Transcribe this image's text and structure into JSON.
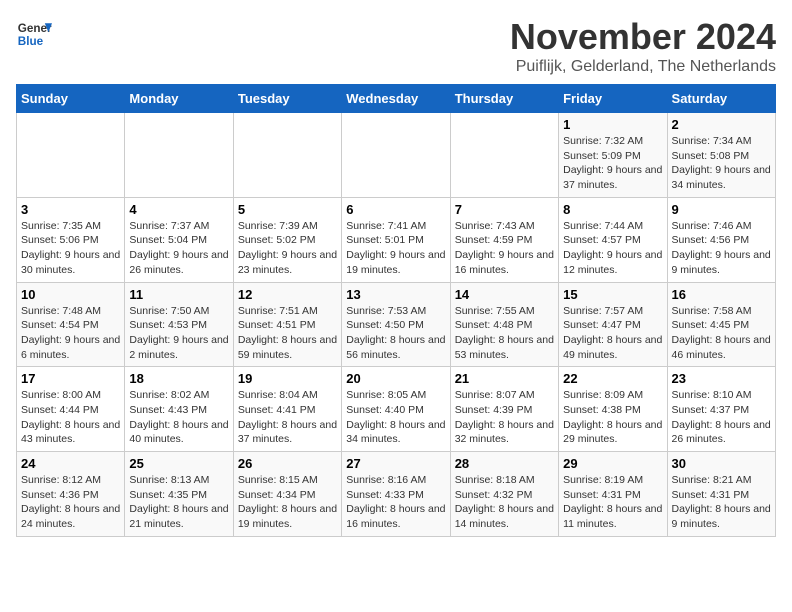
{
  "logo": {
    "line1": "General",
    "line2": "Blue"
  },
  "title": "November 2024",
  "location": "Puiflijk, Gelderland, The Netherlands",
  "headers": [
    "Sunday",
    "Monday",
    "Tuesday",
    "Wednesday",
    "Thursday",
    "Friday",
    "Saturday"
  ],
  "weeks": [
    [
      {
        "day": "",
        "info": ""
      },
      {
        "day": "",
        "info": ""
      },
      {
        "day": "",
        "info": ""
      },
      {
        "day": "",
        "info": ""
      },
      {
        "day": "",
        "info": ""
      },
      {
        "day": "1",
        "info": "Sunrise: 7:32 AM\nSunset: 5:09 PM\nDaylight: 9 hours and 37 minutes."
      },
      {
        "day": "2",
        "info": "Sunrise: 7:34 AM\nSunset: 5:08 PM\nDaylight: 9 hours and 34 minutes."
      }
    ],
    [
      {
        "day": "3",
        "info": "Sunrise: 7:35 AM\nSunset: 5:06 PM\nDaylight: 9 hours and 30 minutes."
      },
      {
        "day": "4",
        "info": "Sunrise: 7:37 AM\nSunset: 5:04 PM\nDaylight: 9 hours and 26 minutes."
      },
      {
        "day": "5",
        "info": "Sunrise: 7:39 AM\nSunset: 5:02 PM\nDaylight: 9 hours and 23 minutes."
      },
      {
        "day": "6",
        "info": "Sunrise: 7:41 AM\nSunset: 5:01 PM\nDaylight: 9 hours and 19 minutes."
      },
      {
        "day": "7",
        "info": "Sunrise: 7:43 AM\nSunset: 4:59 PM\nDaylight: 9 hours and 16 minutes."
      },
      {
        "day": "8",
        "info": "Sunrise: 7:44 AM\nSunset: 4:57 PM\nDaylight: 9 hours and 12 minutes."
      },
      {
        "day": "9",
        "info": "Sunrise: 7:46 AM\nSunset: 4:56 PM\nDaylight: 9 hours and 9 minutes."
      }
    ],
    [
      {
        "day": "10",
        "info": "Sunrise: 7:48 AM\nSunset: 4:54 PM\nDaylight: 9 hours and 6 minutes."
      },
      {
        "day": "11",
        "info": "Sunrise: 7:50 AM\nSunset: 4:53 PM\nDaylight: 9 hours and 2 minutes."
      },
      {
        "day": "12",
        "info": "Sunrise: 7:51 AM\nSunset: 4:51 PM\nDaylight: 8 hours and 59 minutes."
      },
      {
        "day": "13",
        "info": "Sunrise: 7:53 AM\nSunset: 4:50 PM\nDaylight: 8 hours and 56 minutes."
      },
      {
        "day": "14",
        "info": "Sunrise: 7:55 AM\nSunset: 4:48 PM\nDaylight: 8 hours and 53 minutes."
      },
      {
        "day": "15",
        "info": "Sunrise: 7:57 AM\nSunset: 4:47 PM\nDaylight: 8 hours and 49 minutes."
      },
      {
        "day": "16",
        "info": "Sunrise: 7:58 AM\nSunset: 4:45 PM\nDaylight: 8 hours and 46 minutes."
      }
    ],
    [
      {
        "day": "17",
        "info": "Sunrise: 8:00 AM\nSunset: 4:44 PM\nDaylight: 8 hours and 43 minutes."
      },
      {
        "day": "18",
        "info": "Sunrise: 8:02 AM\nSunset: 4:43 PM\nDaylight: 8 hours and 40 minutes."
      },
      {
        "day": "19",
        "info": "Sunrise: 8:04 AM\nSunset: 4:41 PM\nDaylight: 8 hours and 37 minutes."
      },
      {
        "day": "20",
        "info": "Sunrise: 8:05 AM\nSunset: 4:40 PM\nDaylight: 8 hours and 34 minutes."
      },
      {
        "day": "21",
        "info": "Sunrise: 8:07 AM\nSunset: 4:39 PM\nDaylight: 8 hours and 32 minutes."
      },
      {
        "day": "22",
        "info": "Sunrise: 8:09 AM\nSunset: 4:38 PM\nDaylight: 8 hours and 29 minutes."
      },
      {
        "day": "23",
        "info": "Sunrise: 8:10 AM\nSunset: 4:37 PM\nDaylight: 8 hours and 26 minutes."
      }
    ],
    [
      {
        "day": "24",
        "info": "Sunrise: 8:12 AM\nSunset: 4:36 PM\nDaylight: 8 hours and 24 minutes."
      },
      {
        "day": "25",
        "info": "Sunrise: 8:13 AM\nSunset: 4:35 PM\nDaylight: 8 hours and 21 minutes."
      },
      {
        "day": "26",
        "info": "Sunrise: 8:15 AM\nSunset: 4:34 PM\nDaylight: 8 hours and 19 minutes."
      },
      {
        "day": "27",
        "info": "Sunrise: 8:16 AM\nSunset: 4:33 PM\nDaylight: 8 hours and 16 minutes."
      },
      {
        "day": "28",
        "info": "Sunrise: 8:18 AM\nSunset: 4:32 PM\nDaylight: 8 hours and 14 minutes."
      },
      {
        "day": "29",
        "info": "Sunrise: 8:19 AM\nSunset: 4:31 PM\nDaylight: 8 hours and 11 minutes."
      },
      {
        "day": "30",
        "info": "Sunrise: 8:21 AM\nSunset: 4:31 PM\nDaylight: 8 hours and 9 minutes."
      }
    ]
  ]
}
